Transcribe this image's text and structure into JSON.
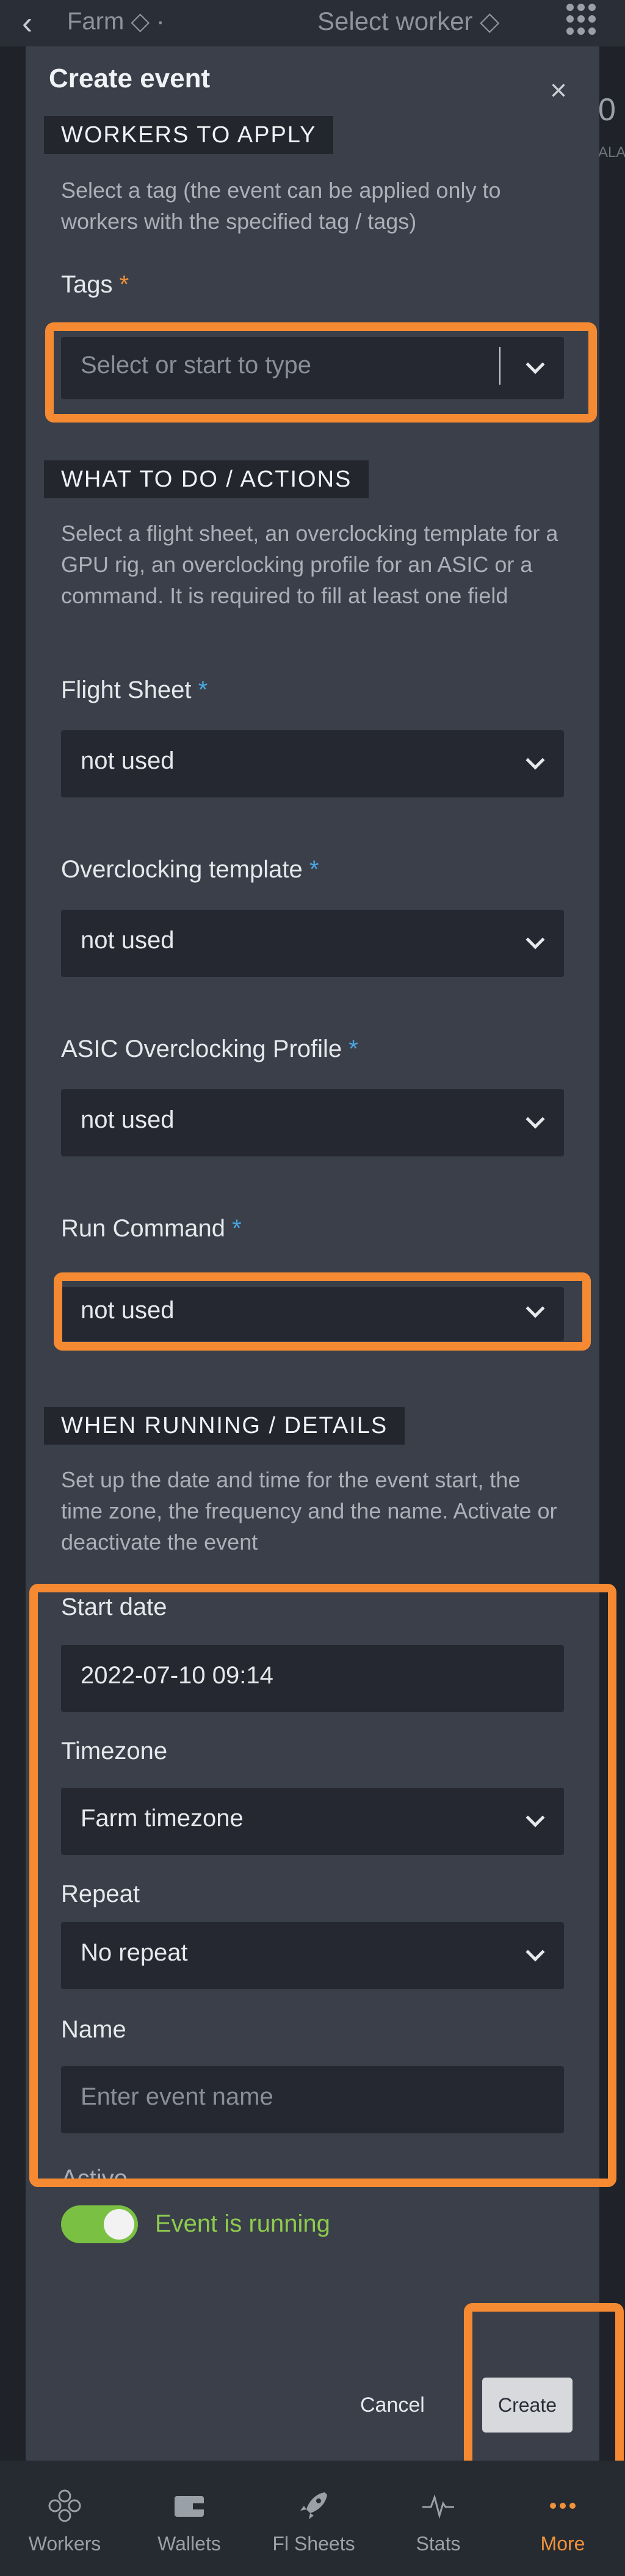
{
  "topbar": {
    "back_glyph": "‹",
    "farm_label": "Farm ◇ ·",
    "worker_label": "Select worker ◇",
    "peek_value": "0",
    "peek_label": "ALA"
  },
  "modal": {
    "title": "Create event",
    "close_glyph": "×"
  },
  "workers": {
    "heading": "WORKERS TO APPLY",
    "description": "Select a tag (the event can be applied only to workers with the specified tag / tags)",
    "tags_label": "Tags",
    "tags_required": "*",
    "tags_placeholder": "Select or start to type"
  },
  "actions": {
    "heading": "WHAT TO DO / ACTIONS",
    "description": "Select a flight sheet, an overclocking template for a GPU rig, an overclocking profile for an ASIC or a command. It is required to fill at least one field",
    "flight_sheet": {
      "label": "Flight Sheet",
      "required": "*",
      "value": "not used"
    },
    "oc_template": {
      "label": "Overclocking template",
      "required": "*",
      "value": "not used"
    },
    "asic_profile": {
      "label": "ASIC Overclocking Profile",
      "required": "*",
      "value": "not used"
    },
    "run_command": {
      "label": "Run Command",
      "required": "*",
      "value": "not used"
    }
  },
  "details": {
    "heading": "WHEN RUNNING / DETAILS",
    "description": "Set up the date and time for the event start, the time zone, the frequency and the name. Activate or deactivate the event",
    "start_date": {
      "label": "Start date",
      "value": "2022-07-10 09:14"
    },
    "timezone": {
      "label": "Timezone",
      "value": "Farm timezone"
    },
    "repeat": {
      "label": "Repeat",
      "value": "No repeat"
    },
    "name": {
      "label": "Name",
      "placeholder": "Enter event name"
    },
    "active": {
      "label": "Active",
      "status": "Event is running",
      "on": true
    }
  },
  "footer": {
    "cancel": "Cancel",
    "create": "Create"
  },
  "tabs": [
    {
      "label": "Workers",
      "icon": "workers-icon"
    },
    {
      "label": "Wallets",
      "icon": "wallet-icon"
    },
    {
      "label": "Fl Sheets",
      "icon": "rocket-icon"
    },
    {
      "label": "Stats",
      "icon": "pulse-icon"
    },
    {
      "label": "More",
      "icon": "more-icon",
      "active": true
    }
  ],
  "colors": {
    "accent": "#f0923a",
    "required_blue": "#4aa6e0",
    "toggle_on": "#7ac143",
    "highlight": "#f58a32"
  }
}
